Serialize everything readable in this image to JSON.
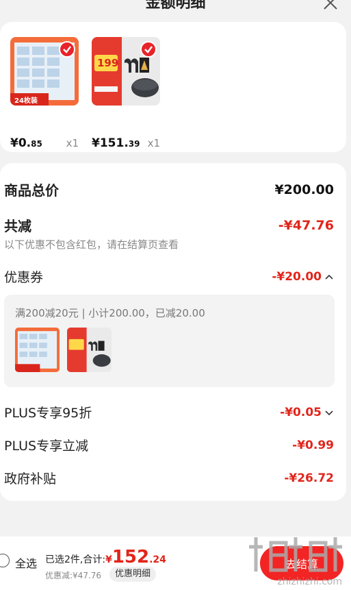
{
  "header": {
    "title": "金额明细"
  },
  "products": [
    {
      "badge": "24枚装",
      "price_int": "¥0.",
      "price_dec": "85",
      "qty": "x1"
    },
    {
      "badge": "199",
      "price_int": "¥151.",
      "price_dec": "39",
      "qty": "x1"
    }
  ],
  "details": {
    "total_label": "商品总价",
    "total_value": "¥200.00",
    "reduce_label": "共减",
    "reduce_value": "-¥47.76",
    "reduce_note": "以下优惠不包含红包，请在结算页查看",
    "coupon_label": "优惠券",
    "coupon_value": "-¥20.00",
    "coupon_desc": "满200减20元 | 小计200.00，已减20.00",
    "plus95_label": "PLUS专享95折",
    "plus95_value": "-¥0.05",
    "plusreduce_label": "PLUS专享立减",
    "plusreduce_value": "-¥0.99",
    "gov_label": "政府补贴",
    "gov_value": "-¥26.72"
  },
  "bottom": {
    "select_all": "全选",
    "selected_text": "已选2件,合计:",
    "yuan": "¥",
    "total_int": "152",
    "total_dec": ".24",
    "discount_text": "优惠减:¥47.76",
    "detail_pill": "优惠明细",
    "checkout": "去结算"
  },
  "watermark": {
    "text": "zhizhizhi.com"
  },
  "colors": {
    "accent": "#e1251b",
    "checkout": "#f22424"
  }
}
